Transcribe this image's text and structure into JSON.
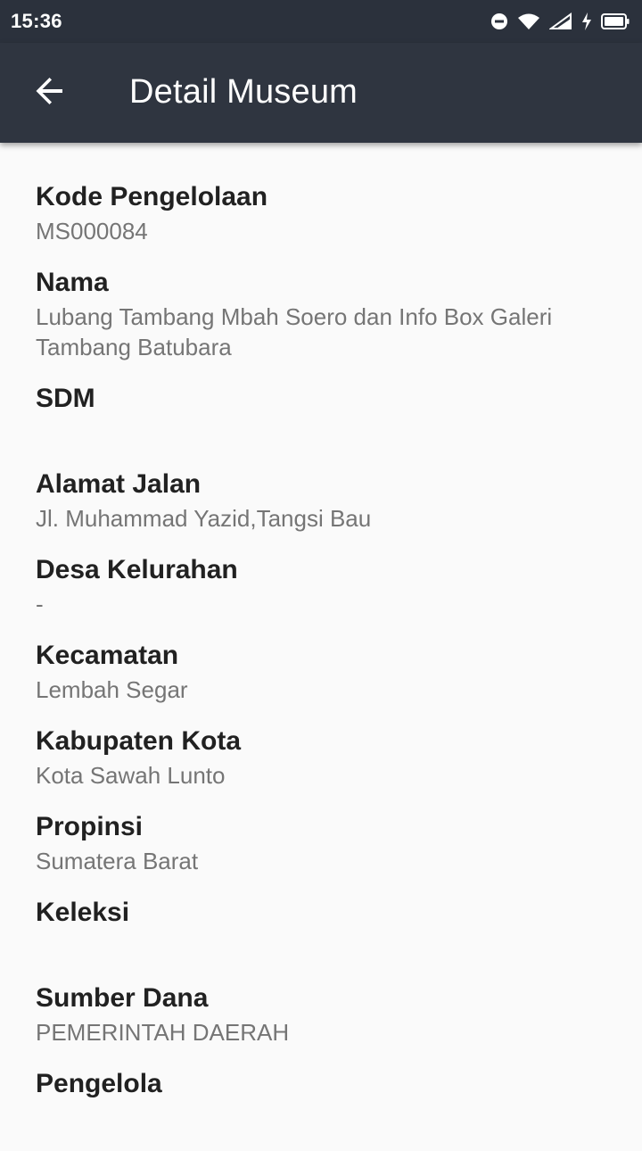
{
  "status_bar": {
    "time": "15:36",
    "icons": [
      "do-not-disturb-icon",
      "wifi-icon",
      "signal-icon",
      "charging-icon",
      "battery-icon"
    ]
  },
  "app_bar": {
    "back_icon": "arrow-back-icon",
    "title": "Detail Museum"
  },
  "fields": {
    "kode": {
      "label": "Kode Pengelolaan",
      "value": "MS000084"
    },
    "nama": {
      "label": "Nama",
      "value": "Lubang Tambang Mbah Soero dan Info Box Galeri Tambang Batubara"
    },
    "sdm": {
      "label": "SDM",
      "value": ""
    },
    "alamat": {
      "label": "Alamat Jalan",
      "value": "Jl. Muhammad Yazid,Tangsi Bau"
    },
    "desa": {
      "label": "Desa Kelurahan",
      "value": "-"
    },
    "kecamatan": {
      "label": "Kecamatan",
      "value": "Lembah Segar"
    },
    "kabupaten": {
      "label": "Kabupaten Kota",
      "value": "Kota Sawah Lunto"
    },
    "propinsi": {
      "label": "Propinsi",
      "value": "Sumatera Barat"
    },
    "koleksi": {
      "label": "Keleksi",
      "value": ""
    },
    "sumber_dana": {
      "label": "Sumber Dana",
      "value": "PEMERINTAH DAERAH"
    },
    "pengelola": {
      "label": "Pengelola",
      "value": ""
    }
  },
  "colors": {
    "status_bar": "#2b313c",
    "app_bar": "#2f3540",
    "background": "#fafafa",
    "label": "#212121",
    "value": "#757575"
  }
}
